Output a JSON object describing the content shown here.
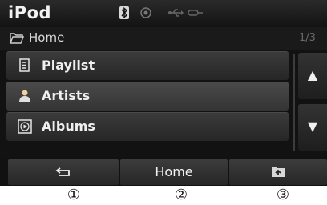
{
  "app": {
    "title": "iPod"
  },
  "status": {
    "icons": [
      "bluetooth-icon",
      "record-icon",
      "usb-icon",
      "aux-icon"
    ]
  },
  "path": {
    "text": "Home",
    "page": "1/3"
  },
  "list": {
    "items": [
      {
        "label": "Playlist",
        "icon": "playlist-icon"
      },
      {
        "label": "Artists",
        "icon": "artist-icon"
      },
      {
        "label": "Albums",
        "icon": "album-icon"
      }
    ]
  },
  "scroll": {
    "up": "▲",
    "down": "▼"
  },
  "bottom": {
    "back_icon": "back-icon",
    "home_label": "Home",
    "upfolder_icon": "up-folder-icon"
  },
  "callouts": [
    "①",
    "②",
    "③"
  ],
  "colors": {
    "screen_bg": "#121212",
    "text": "#f0f0f0"
  }
}
